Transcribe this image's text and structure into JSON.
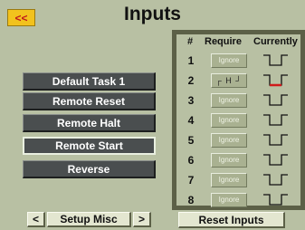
{
  "header": {
    "back_label": "<<",
    "title": "Inputs"
  },
  "tasks": [
    "Default Task 1",
    "Remote Reset",
    "Remote Halt",
    "Remote Start",
    "Reverse"
  ],
  "table": {
    "headers": {
      "num": "#",
      "require": "Require",
      "currently": "Currently"
    },
    "rows": [
      {
        "num": "1",
        "require": "Ignore",
        "active": false
      },
      {
        "num": "2",
        "require": "H",
        "active": true
      },
      {
        "num": "3",
        "require": "Ignore",
        "active": false
      },
      {
        "num": "4",
        "require": "Ignore",
        "active": false
      },
      {
        "num": "5",
        "require": "Ignore",
        "active": false
      },
      {
        "num": "6",
        "require": "Ignore",
        "active": false
      },
      {
        "num": "7",
        "require": "Ignore",
        "active": false
      },
      {
        "num": "8",
        "require": "Ignore",
        "active": false
      }
    ]
  },
  "footer": {
    "prev_label": "<",
    "setup_label": "Setup Misc",
    "next_label": ">",
    "reset_label": "Reset Inputs"
  },
  "colors": {
    "accent": "#f2c21d",
    "active_line": "#d01a1a",
    "button_dark": "#4a4e4f"
  }
}
